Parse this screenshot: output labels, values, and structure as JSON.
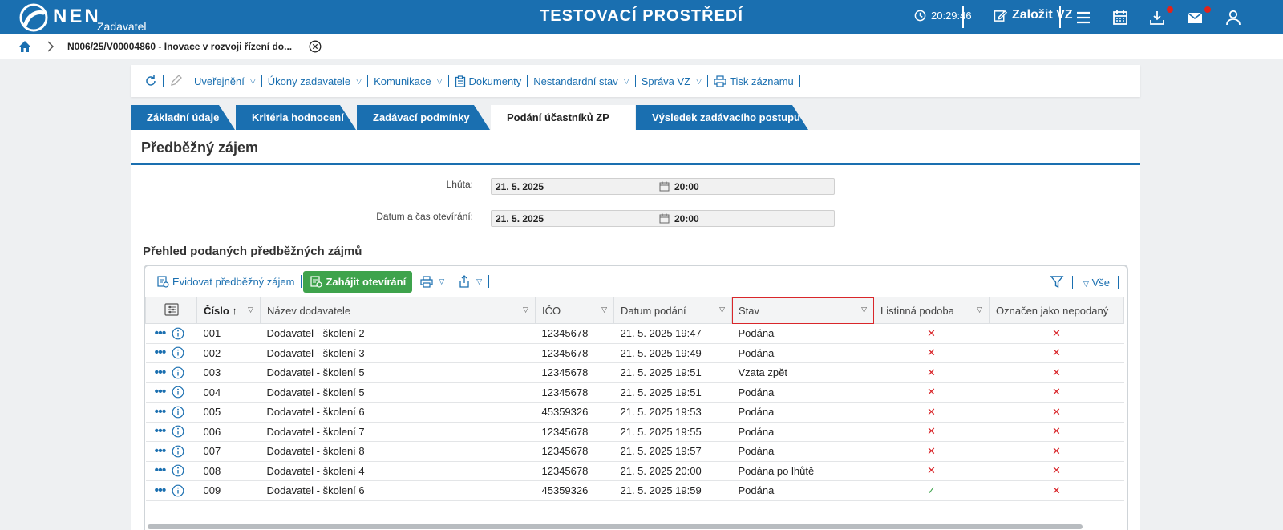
{
  "header": {
    "logo_text": "NEN",
    "logo_sub": "Zadavatel",
    "env_title": "TESTOVACÍ PROSTŘEDÍ",
    "clock": "20:29:46",
    "create_label": "Založit VZ",
    "icons": [
      "clock-icon",
      "edit-icon",
      "menu-icon",
      "calendar-icon",
      "download-icon",
      "mail-icon",
      "user-icon"
    ],
    "accent": "#1a6fb0",
    "notification_color": "#e2231a"
  },
  "breadcrumb": {
    "home_icon": "home-icon",
    "item": "N006/25/V00004860 - Inovace v rozvoji řízení do..."
  },
  "actions": {
    "publish": "Uveřejnění",
    "acts": "Úkony zadavatele",
    "communication": "Komunikace",
    "documents": "Dokumenty",
    "nonstandard": "Nestandardní stav",
    "manage": "Správa VZ",
    "print": "Tisk záznamu"
  },
  "tabs": [
    {
      "label": "Základní údaje",
      "active": false
    },
    {
      "label": "Kritéria hodnocení",
      "active": false
    },
    {
      "label": "Zadávací podmínky",
      "active": false
    },
    {
      "label": "Podání účastníků ZP",
      "active": true
    },
    {
      "label": "Výsledek zadávacího postupu",
      "active": false
    }
  ],
  "panel": {
    "title": "Předběžný zájem",
    "deadline_label": "Lhůta:",
    "deadline_date": "21. 5. 2025",
    "deadline_time": "20:00",
    "opening_label": "Datum a čas otevírání:",
    "opening_date": "21. 5. 2025",
    "opening_time": "20:00",
    "overview_title": "Přehled podaných předběžných zájmů"
  },
  "grid": {
    "toolbar": {
      "register": "Evidovat předběžný zájem",
      "start_opening": "Zahájit otevírání",
      "all_filter": "Vše",
      "start_color": "#3ea34c"
    },
    "columns": [
      "Číslo",
      "Název dodavatele",
      "IČO",
      "Datum podání",
      "Stav",
      "Listinná podoba",
      "Označen jako nepodaný"
    ],
    "rows": [
      {
        "num": "001",
        "name": "Dodavatel - školení 2",
        "ico": "12345678",
        "date": "21. 5. 2025 19:47",
        "state": "Podána",
        "paper": false,
        "unsubmitted": false
      },
      {
        "num": "002",
        "name": "Dodavatel - školení 3",
        "ico": "12345678",
        "date": "21. 5. 2025 19:49",
        "state": "Podána",
        "paper": false,
        "unsubmitted": false
      },
      {
        "num": "003",
        "name": "Dodavatel - školení 5",
        "ico": "12345678",
        "date": "21. 5. 2025 19:51",
        "state": "Vzata zpět",
        "paper": false,
        "unsubmitted": false
      },
      {
        "num": "004",
        "name": "Dodavatel - školení 5",
        "ico": "12345678",
        "date": "21. 5. 2025 19:51",
        "state": "Podána",
        "paper": false,
        "unsubmitted": false
      },
      {
        "num": "005",
        "name": "Dodavatel - školení 6",
        "ico": "45359326",
        "date": "21. 5. 2025 19:53",
        "state": "Podána",
        "paper": false,
        "unsubmitted": false
      },
      {
        "num": "006",
        "name": "Dodavatel - školení 7",
        "ico": "12345678",
        "date": "21. 5. 2025 19:55",
        "state": "Podána",
        "paper": false,
        "unsubmitted": false
      },
      {
        "num": "007",
        "name": "Dodavatel - školení 8",
        "ico": "12345678",
        "date": "21. 5. 2025 19:57",
        "state": "Podána",
        "paper": false,
        "unsubmitted": false
      },
      {
        "num": "008",
        "name": "Dodavatel - školení 4",
        "ico": "12345678",
        "date": "21. 5. 2025 20:00",
        "state": "Podána po lhůtě",
        "paper": false,
        "unsubmitted": false
      },
      {
        "num": "009",
        "name": "Dodavatel - školení 6",
        "ico": "45359326",
        "date": "21. 5. 2025 19:59",
        "state": "Podána",
        "paper": true,
        "unsubmitted": false
      }
    ]
  }
}
